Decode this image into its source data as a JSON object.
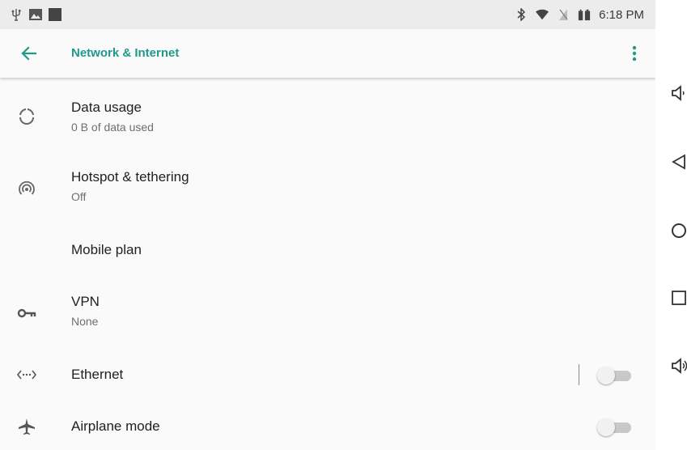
{
  "status_bar": {
    "time": "6:18 PM",
    "left_icons": [
      "usb-icon",
      "image-icon",
      "app-icon"
    ],
    "right_icons": [
      "bluetooth-icon",
      "wifi-icon",
      "no-sim-icon",
      "battery-icon"
    ]
  },
  "app_bar": {
    "title": "Network & Internet",
    "back_icon": "arrow-left-icon",
    "more_icon": "more-vert-icon",
    "accent_color": "#20998a"
  },
  "items": [
    {
      "label": "Data usage",
      "summary": "0 B of data used",
      "icon": "data-usage-icon"
    },
    {
      "label": "Hotspot & tethering",
      "summary": "Off",
      "icon": "hotspot-icon"
    },
    {
      "label": "Mobile plan",
      "summary": "",
      "icon": ""
    },
    {
      "label": "VPN",
      "summary": "None",
      "icon": "key-icon"
    },
    {
      "label": "Ethernet",
      "summary": "",
      "icon": "ethernet-icon",
      "toggle_on": false
    },
    {
      "label": "Airplane mode",
      "summary": "",
      "icon": "airplane-icon",
      "toggle_on": false
    }
  ],
  "nav_bar": {
    "buttons": [
      "volume-down-icon",
      "back-icon",
      "home-icon",
      "recents-icon",
      "volume-up-icon"
    ]
  }
}
